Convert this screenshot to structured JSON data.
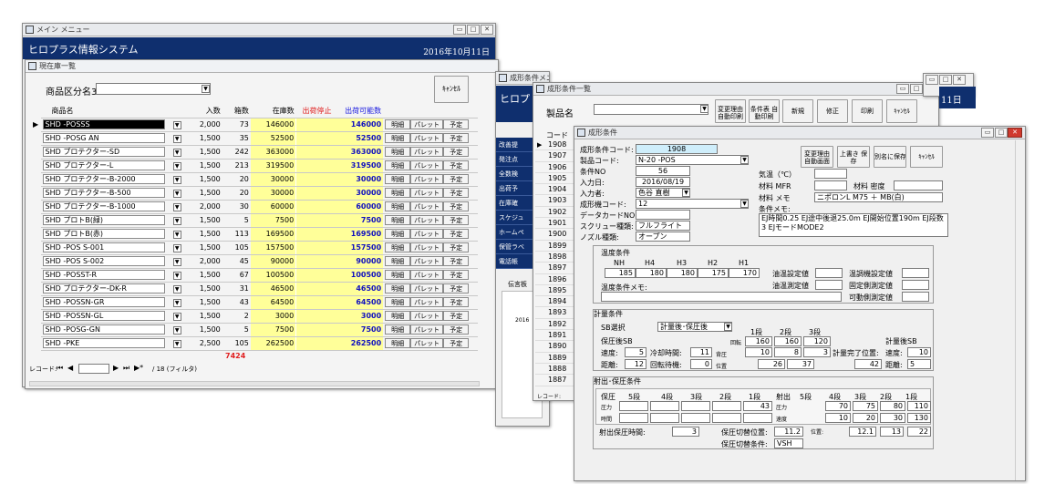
{
  "main_window": {
    "title": "メイン メニュー",
    "app_title": "ヒロプラス情報システム",
    "date": "2016年10月11日"
  },
  "stock_window": {
    "title": "現在庫一覧",
    "category_label": "商品区分名3",
    "cancel_label": "ｷｬﾝｾﾙ",
    "columns": [
      "商品名",
      "入数",
      "箱数",
      "在庫数",
      "出荷停止",
      "出荷可能数"
    ],
    "row_buttons": [
      "明細",
      "パレット",
      "予定"
    ],
    "rows": [
      {
        "name": "SHD -POSSS",
        "qty": "2,000",
        "boxes": "73",
        "stock": "146000",
        "stop": "",
        "available": "146000"
      },
      {
        "name": "SHD -POSG AN",
        "qty": "1,500",
        "boxes": "35",
        "stock": "52500",
        "stop": "",
        "available": "52500"
      },
      {
        "name": "SHD プロテクター-SD",
        "qty": "1,500",
        "boxes": "242",
        "stock": "363000",
        "stop": "",
        "available": "363000"
      },
      {
        "name": "SHD プロテクター-L",
        "qty": "1,500",
        "boxes": "213",
        "stock": "319500",
        "stop": "",
        "available": "319500"
      },
      {
        "name": "SHD プロテクター-B-2000",
        "qty": "1,500",
        "boxes": "20",
        "stock": "30000",
        "stop": "",
        "available": "30000"
      },
      {
        "name": "SHD プロテクター-B-500",
        "qty": "1,500",
        "boxes": "20",
        "stock": "30000",
        "stop": "",
        "available": "30000"
      },
      {
        "name": "SHD プロテクター-B-1000",
        "qty": "2,000",
        "boxes": "30",
        "stock": "60000",
        "stop": "",
        "available": "60000"
      },
      {
        "name": "SHD プロトB(緑)",
        "qty": "1,500",
        "boxes": "5",
        "stock": "7500",
        "stop": "",
        "available": "7500"
      },
      {
        "name": "SHD プロトB(赤)",
        "qty": "1,500",
        "boxes": "113",
        "stock": "169500",
        "stop": "",
        "available": "169500"
      },
      {
        "name": "SHD -POS S-001",
        "qty": "1,500",
        "boxes": "105",
        "stock": "157500",
        "stop": "",
        "available": "157500"
      },
      {
        "name": "SHD -POS S-002",
        "qty": "2,000",
        "boxes": "45",
        "stock": "90000",
        "stop": "",
        "available": "90000"
      },
      {
        "name": "SHD -POSST-R",
        "qty": "1,500",
        "boxes": "67",
        "stock": "100500",
        "stop": "",
        "available": "100500"
      },
      {
        "name": "SHD プロテクター-DK-R",
        "qty": "1,500",
        "boxes": "31",
        "stock": "46500",
        "stop": "",
        "available": "46500"
      },
      {
        "name": "SHD -POSSN-GR",
        "qty": "1,500",
        "boxes": "43",
        "stock": "64500",
        "stop": "",
        "available": "64500"
      },
      {
        "name": "SHD -POSSN-GL",
        "qty": "1,500",
        "boxes": "2",
        "stock": "3000",
        "stop": "",
        "available": "3000"
      },
      {
        "name": "SHD -POSG-GN",
        "qty": "1,500",
        "boxes": "5",
        "stock": "7500",
        "stop": "",
        "available": "7500"
      },
      {
        "name": "SHD -PKE",
        "qty": "2,500",
        "boxes": "105",
        "stock": "262500",
        "stop": "",
        "available": "262500"
      }
    ],
    "total_boxes": "7424",
    "record_label": "レコード:",
    "record_filter": "/ 18 (フィルタ)"
  },
  "menu2_window": {
    "title": "成形条件メニュー",
    "app_title": "ヒロプ",
    "menu_items": [
      "改善提",
      "発注点",
      "全数検",
      "出荷予",
      "在庫確",
      "スケジュ",
      "ホームペ",
      "保管ラベ",
      "電話帳"
    ],
    "side_label": "伝言板",
    "side_year": "2016"
  },
  "list_window": {
    "title": "成形条件一覧",
    "product_label": "製品名",
    "buttons": [
      "変更理由 自動印刷",
      "条件表 自動印刷",
      "新規",
      "修正",
      "印刷",
      "ｷｬﾝｾﾙ"
    ],
    "code_header": "コード",
    "codes": [
      "1908",
      "1907",
      "1906",
      "1905",
      "1904",
      "1903",
      "1902",
      "1901",
      "1900",
      "1899",
      "1898",
      "1897",
      "1896",
      "1895",
      "1894",
      "1893",
      "1892",
      "1891",
      "1890",
      "1889",
      "1888",
      "1887"
    ],
    "date_fragment": "11日",
    "record_label": "レコード:"
  },
  "detail_window": {
    "title": "成形条件",
    "fields": {
      "code_label": "成形条件コード:",
      "code": "1908",
      "product_code_label": "製品コード:",
      "product_code": "N-20 -POS",
      "condition_no_label": "条件NO",
      "condition_no": "56",
      "input_date_label": "入力日:",
      "input_date": "2016/08/19",
      "inputter_label": "入力者:",
      "inputter": "色谷 直樹",
      "machine_code_label": "成形機コード:",
      "machine_code": "12",
      "datacard_label": "データカードNO:",
      "datacard": "",
      "screw_label": "スクリュー種類:",
      "screw": "フルフライト",
      "nozzle_label": "ノズル種類:",
      "nozzle": "オープン",
      "temp_label": "気温（℃）",
      "temp": "",
      "material_mfr_label": "材料 MFR",
      "material_mfr": "",
      "density_label": "材料 密度",
      "density": "",
      "material_memo_label": "材料 メモ",
      "material_memo": "ニポロンL M75 ＋ MB(白)",
      "condition_memo_label": "条件メモ:",
      "condition_memo": "EJ時間0.25 EJ途中後退25.0m EJ開始位置190m EJ段数3 EJモードMODE2"
    },
    "buttons": [
      "変更理由 自動画面",
      "上書き 保存",
      "別名に保存",
      "ｷｬﾝｾﾙ"
    ],
    "temp_section": {
      "title": "温度条件",
      "headers": [
        "NH",
        "H4",
        "H3",
        "H2",
        "H1"
      ],
      "values": [
        "185",
        "180",
        "180",
        "175",
        "170"
      ],
      "mold_set_label": "油温設定値",
      "mold_measure_label": "油温測定値",
      "chiller_set_label": "温調機設定値",
      "fixed_measure_label": "固定側測定値",
      "movable_measure_label": "可動側測定値",
      "memo_label": "温度条件メモ:"
    },
    "metering_section": {
      "title": "計量条件",
      "sb_label": "SB選択",
      "sb_value": "計量後･保圧後",
      "stage_headers": [
        "1段",
        "2段",
        "3段"
      ],
      "rotation_label": "回転",
      "rotation_values": [
        "160",
        "160",
        "120"
      ],
      "back_pressure_label": "背圧",
      "back_pressure_values": [
        "10",
        "8",
        "3"
      ],
      "position_label": "位置",
      "position_values": [
        "26",
        "37",
        "42"
      ],
      "hold_sb_label": "保圧後SB",
      "meter_sb_label": "計量後SB",
      "speed_label": "速度:",
      "hold_speed": "5",
      "cooling_label": "冷却時間:",
      "cooling": "11",
      "distance_label": "距離:",
      "hold_distance": "12",
      "rotation_wait_label": "回転待機:",
      "rotation_wait": "0",
      "complete_label": "計量完了位置:",
      "meter_speed": "10",
      "meter_distance": "5"
    },
    "injection_section": {
      "title": "射出･保圧条件",
      "hold_label": "保圧",
      "hold_stages": [
        "5段",
        "4段",
        "3段",
        "2段",
        "1段"
      ],
      "pressure_label": "圧力",
      "hold_pressure": [
        "",
        "",
        "",
        "",
        "43"
      ],
      "time_label": "時間",
      "inject_label": "射出",
      "inject_stages": [
        "5段",
        "4段",
        "3段",
        "2段",
        "1段"
      ],
      "inject_pressure": [
        "",
        "",
        "70",
        "75",
        "80",
        "110"
      ],
      "inject_speed_label": "速度",
      "inject_speed": [
        "",
        "",
        "10",
        "20",
        "30",
        "130"
      ],
      "hold_time_label": "射出保圧時間:",
      "hold_time": "3",
      "switch_pos_label": "保圧切替位置:",
      "switch_pos": "11.2",
      "position_label": "位置:",
      "positions": [
        "12.1",
        "13",
        "22"
      ],
      "switch_cond_label": "保圧切替条件:",
      "switch_cond": "VSH"
    }
  }
}
